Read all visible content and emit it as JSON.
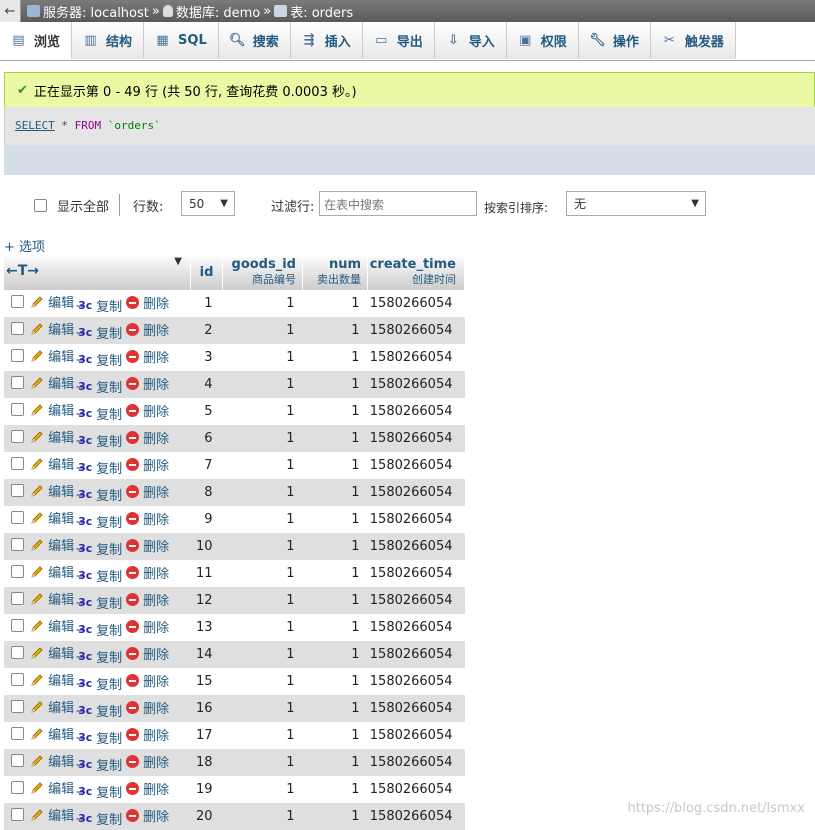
{
  "breadcrumb": {
    "server_label": "服务器: localhost",
    "db_label": "数据库: demo",
    "table_label": "表: orders",
    "sep": "»"
  },
  "tabs": [
    {
      "label": "浏览",
      "icon": "browse-icon",
      "active": true
    },
    {
      "label": "结构",
      "icon": "structure-icon"
    },
    {
      "label": "SQL",
      "icon": "sql-icon"
    },
    {
      "label": "搜索",
      "icon": "search-icon"
    },
    {
      "label": "插入",
      "icon": "insert-icon"
    },
    {
      "label": "导出",
      "icon": "export-icon"
    },
    {
      "label": "导入",
      "icon": "import-icon"
    },
    {
      "label": "权限",
      "icon": "privileges-icon"
    },
    {
      "label": "操作",
      "icon": "wrench-icon"
    },
    {
      "label": "触发器",
      "icon": "triggers-icon"
    }
  ],
  "message": "正在显示第 0 - 49 行 (共 50 行, 查询花费 0.0003 秒。)",
  "sql": {
    "select": "SELECT",
    "star": " * ",
    "from": "FROM",
    "table": " `orders`"
  },
  "nav": {
    "show_all": "显示全部",
    "rows_label": "行数:",
    "rows_value": "50",
    "filter_label": "过滤行:",
    "filter_placeholder": "在表中搜索",
    "sort_label": "按索引排序:",
    "sort_value": "无"
  },
  "options_label": "+ 选项",
  "columns": [
    {
      "name": "id",
      "comment": ""
    },
    {
      "name": "goods_id",
      "comment": "商品编号"
    },
    {
      "name": "num",
      "comment": "卖出数量"
    },
    {
      "name": "create_time",
      "comment": "创建时间"
    }
  ],
  "actions": {
    "edit": "编辑",
    "copy": "复制",
    "delete": "删除"
  },
  "rows": [
    {
      "id": "1",
      "goods_id": "1",
      "num": "1",
      "create_time": "1580266054"
    },
    {
      "id": "2",
      "goods_id": "1",
      "num": "1",
      "create_time": "1580266054"
    },
    {
      "id": "3",
      "goods_id": "1",
      "num": "1",
      "create_time": "1580266054"
    },
    {
      "id": "4",
      "goods_id": "1",
      "num": "1",
      "create_time": "1580266054"
    },
    {
      "id": "5",
      "goods_id": "1",
      "num": "1",
      "create_time": "1580266054"
    },
    {
      "id": "6",
      "goods_id": "1",
      "num": "1",
      "create_time": "1580266054"
    },
    {
      "id": "7",
      "goods_id": "1",
      "num": "1",
      "create_time": "1580266054"
    },
    {
      "id": "8",
      "goods_id": "1",
      "num": "1",
      "create_time": "1580266054"
    },
    {
      "id": "9",
      "goods_id": "1",
      "num": "1",
      "create_time": "1580266054"
    },
    {
      "id": "10",
      "goods_id": "1",
      "num": "1",
      "create_time": "1580266054"
    },
    {
      "id": "11",
      "goods_id": "1",
      "num": "1",
      "create_time": "1580266054"
    },
    {
      "id": "12",
      "goods_id": "1",
      "num": "1",
      "create_time": "1580266054"
    },
    {
      "id": "13",
      "goods_id": "1",
      "num": "1",
      "create_time": "1580266054"
    },
    {
      "id": "14",
      "goods_id": "1",
      "num": "1",
      "create_time": "1580266054"
    },
    {
      "id": "15",
      "goods_id": "1",
      "num": "1",
      "create_time": "1580266054"
    },
    {
      "id": "16",
      "goods_id": "1",
      "num": "1",
      "create_time": "1580266054"
    },
    {
      "id": "17",
      "goods_id": "1",
      "num": "1",
      "create_time": "1580266054"
    },
    {
      "id": "18",
      "goods_id": "1",
      "num": "1",
      "create_time": "1580266054"
    },
    {
      "id": "19",
      "goods_id": "1",
      "num": "1",
      "create_time": "1580266054"
    },
    {
      "id": "20",
      "goods_id": "1",
      "num": "1",
      "create_time": "1580266054"
    }
  ],
  "watermark": "https://blog.csdn.net/lsmxx"
}
